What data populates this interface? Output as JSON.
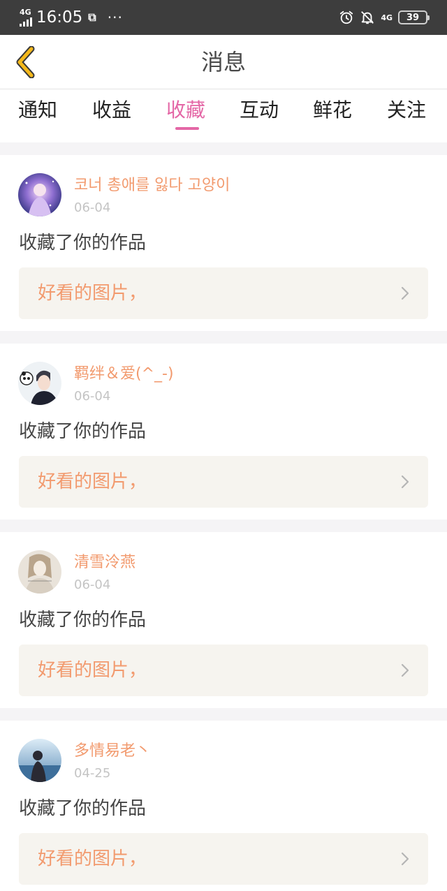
{
  "status_bar": {
    "network": "4G",
    "time": "16:05",
    "shot_glyph": "⧉",
    "dots": "···",
    "network_right": "4G",
    "battery": "39"
  },
  "header": {
    "title": "消息"
  },
  "tabs": [
    {
      "label": "通知",
      "active": false
    },
    {
      "label": "收益",
      "active": false
    },
    {
      "label": "收藏",
      "active": true
    },
    {
      "label": "互动",
      "active": false
    },
    {
      "label": "鲜花",
      "active": false
    },
    {
      "label": "关注",
      "active": false
    }
  ],
  "notifications": [
    {
      "username": "코너 총애를 잃다 고양이",
      "date": "06-04",
      "action": "收藏了你的作品",
      "work_title": "好看的图片，",
      "avatar_icon": "galaxy-girl-avatar"
    },
    {
      "username": "羁绊＆爱(^_-)",
      "date": "06-04",
      "action": "收藏了你的作品",
      "work_title": "好看的图片，",
      "avatar_icon": "boy-with-panda-avatar"
    },
    {
      "username": "清雪泠燕",
      "date": "06-04",
      "action": "收藏了你的作品",
      "work_title": "好看的图片，",
      "avatar_icon": "sketch-girl-avatar"
    },
    {
      "username": "多情易老丶",
      "date": "04-25",
      "action": "收藏了你的作品",
      "work_title": "好看的图片，",
      "avatar_icon": "seaside-girl-avatar"
    }
  ],
  "colors": {
    "accent_pink": "#e467a6",
    "username_orange": "#f29a6e",
    "back_arrow_yellow": "#f5b91b",
    "work_bg": "#f6f4ef"
  }
}
